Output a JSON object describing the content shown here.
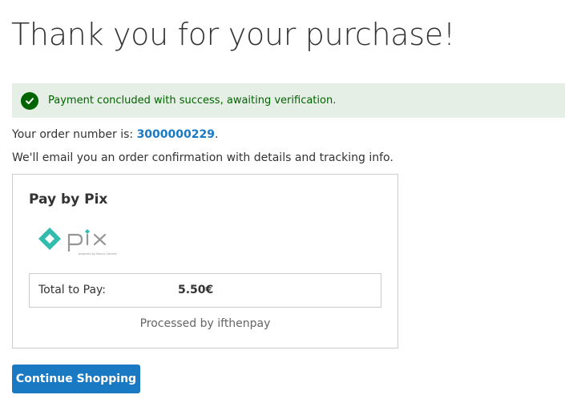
{
  "page": {
    "title": "Thank you for your purchase!"
  },
  "message": {
    "text": "Payment concluded with success, awaiting verification.",
    "icon": "check-circle-icon",
    "color": "#006400",
    "background": "#e5efe5"
  },
  "order": {
    "prefix": "Your order number is: ",
    "number": "3000000229",
    "suffix": ".",
    "link_color": "#1979c3"
  },
  "email_notice": "We'll email you an order confirmation with details and tracking info.",
  "payment": {
    "title": "Pay by Pix",
    "logo": {
      "icon": "pix-logo-icon",
      "wordmark": "pix",
      "tagline": "powered by Banco Central",
      "color": "#32bcad"
    },
    "total_label": "Total to Pay:",
    "total_value": "5.50€",
    "processed_by": "Processed by ifthenpay"
  },
  "actions": {
    "continue_label": "Continue Shopping",
    "button_color": "#1979c3"
  }
}
